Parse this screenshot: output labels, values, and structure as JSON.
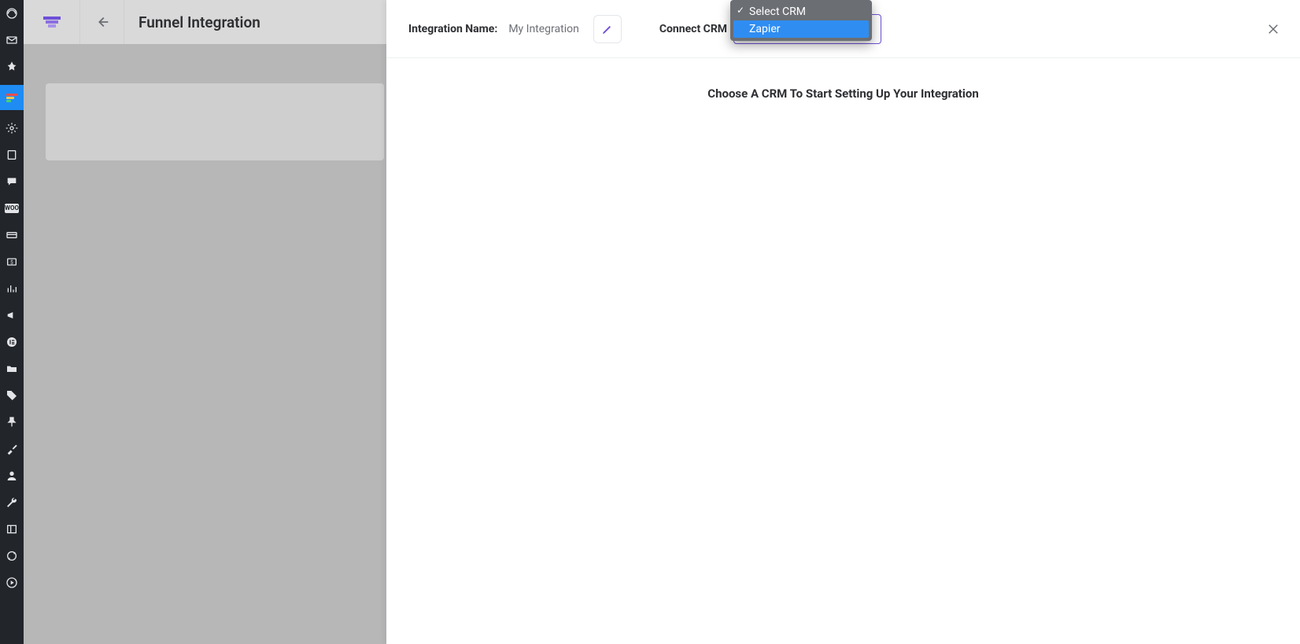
{
  "nav": {
    "items": [
      {
        "name": "dashboard-icon"
      },
      {
        "name": "mail-icon"
      },
      {
        "name": "pin-icon"
      },
      {
        "name": "funnel-icon",
        "active": true
      },
      {
        "name": "settings-icon"
      },
      {
        "name": "book-icon"
      },
      {
        "name": "chat-icon"
      },
      {
        "name": "woo-badge",
        "text": "WOO"
      },
      {
        "name": "card-icon"
      },
      {
        "name": "money-icon"
      },
      {
        "name": "analytics-icon"
      },
      {
        "name": "megaphone-icon"
      },
      {
        "name": "elementor-icon"
      },
      {
        "name": "folder-icon"
      },
      {
        "name": "tag-icon"
      },
      {
        "name": "pin2-icon"
      },
      {
        "name": "brush-icon"
      },
      {
        "name": "user-icon"
      },
      {
        "name": "wrench-icon"
      },
      {
        "name": "collapse-icon"
      },
      {
        "name": "refresh-icon"
      },
      {
        "name": "play-icon"
      }
    ]
  },
  "underlay": {
    "title": "Funnel Integration"
  },
  "panel": {
    "integration_label": "Integration Name:",
    "integration_value": "My Integration",
    "connect_label": "Connect CRM",
    "dropdown": {
      "placeholder": "Select CRM",
      "options": [
        "Zapier"
      ]
    },
    "body_message": "Choose A CRM To Start Setting Up Your Integration"
  }
}
